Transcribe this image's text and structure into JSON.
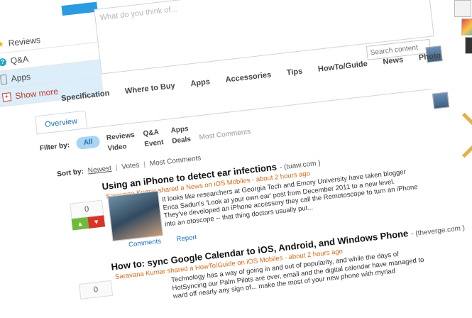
{
  "sidebar": {
    "items": [
      {
        "label": "Reviews",
        "icon": "star-icon"
      },
      {
        "label": "Q&A",
        "icon": "question-icon"
      },
      {
        "label": "Apps",
        "icon": "phone-icon"
      },
      {
        "label": "Show more",
        "icon": "plus-icon"
      }
    ]
  },
  "composer": {
    "placeholder": "What do you think of..."
  },
  "category_tabs": [
    "Specification",
    "Where to Buy",
    "Apps",
    "Accessories",
    "Tips",
    "HowTo/Guide",
    "News",
    "Photo"
  ],
  "search": {
    "placeholder": "Search content"
  },
  "sub_tabs": {
    "overview": "Overview"
  },
  "filter": {
    "label": "Filter by:",
    "all": "All",
    "col1": [
      "Reviews",
      "Video"
    ],
    "col2": [
      "Q&A",
      "Event"
    ],
    "col3": [
      "Apps",
      "Deals"
    ],
    "extra": "Most Comments"
  },
  "sort": {
    "label": "Sort by:",
    "newest": "Newest",
    "votes": "Votes",
    "most_comments": "Most Comments",
    "sep": "|"
  },
  "items": [
    {
      "title": "Using an iPhone to detect ear infections",
      "source": "- (tuaw.com )",
      "meta": "Saravana Kumar shared a News on iOS Mobiles - about 2 hours ago",
      "body": "It looks like researchers at Georgia Tech and Emory University have taken blogger Erica Sadun's 'Look at your own ear' post from December 2011 to a new level. They've developed an iPhone accessory they call the Remotoscope to turn an iPhone into an otoscope -- that thing doctors usually put...",
      "votes": "0",
      "comments": "Comments",
      "report": "Report"
    },
    {
      "title": "How to: sync Google Calendar to iOS, Android, and Windows Phone",
      "source": "- (theverge.com )",
      "meta": "Saravana Kumar shared a HowTo/Guide on iOS Mobiles - about 2 hours ago",
      "body": "Technology has a way of going in and out of popularity, and while the days of HotSyncing our Palm Pilots are over, email and the digital calendar have managed to ward off nearly any sign of... make the most of your new phone with myriad",
      "votes": "0"
    }
  ]
}
